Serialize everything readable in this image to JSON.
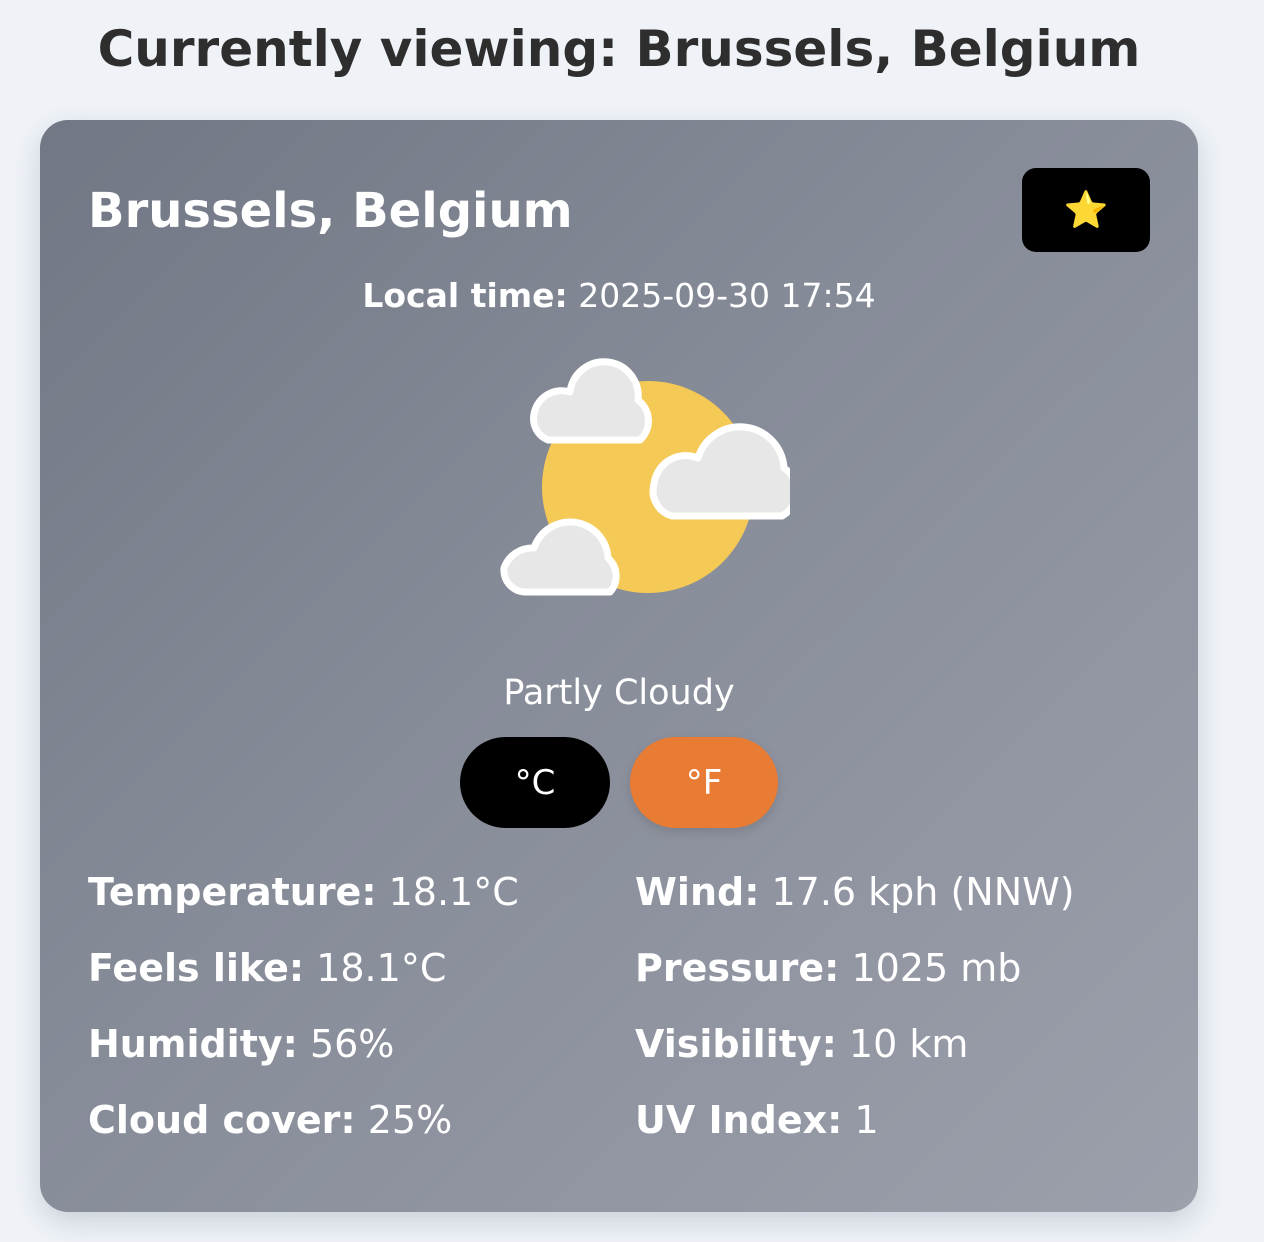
{
  "page": {
    "heading": "Currently viewing: Brussels, Belgium"
  },
  "card": {
    "city": "Brussels, Belgium",
    "favorite_icon": "star-icon",
    "favorite_glyph": "⭐",
    "local_time_label": "Local time:",
    "local_time_value": "2025-09-30 17:54",
    "weather_icon": "partly-cloudy-icon",
    "condition": "Partly Cloudy",
    "units": {
      "celsius_label": "°C",
      "fahrenheit_label": "°F",
      "selected": "°F"
    },
    "stats_left": [
      {
        "label": "Temperature:",
        "value": "18.1°C"
      },
      {
        "label": "Feels like:",
        "value": "18.1°C"
      },
      {
        "label": "Humidity:",
        "value": "56%"
      },
      {
        "label": "Cloud cover:",
        "value": "25%"
      }
    ],
    "stats_right": [
      {
        "label": "Wind:",
        "value": "17.6 kph (NNW)"
      },
      {
        "label": "Pressure:",
        "value": "1025 mb"
      },
      {
        "label": "Visibility:",
        "value": "10 km"
      },
      {
        "label": "UV Index:",
        "value": "1"
      }
    ]
  },
  "colors": {
    "page_background": "#eff3f8",
    "card_gradient_start": "#717784",
    "card_gradient_end": "#9ca0ab",
    "celsius_button": "#000000",
    "fahrenheit_button": "#e87c34",
    "sun": "#f5c955",
    "cloud": "#e7e7e7"
  }
}
